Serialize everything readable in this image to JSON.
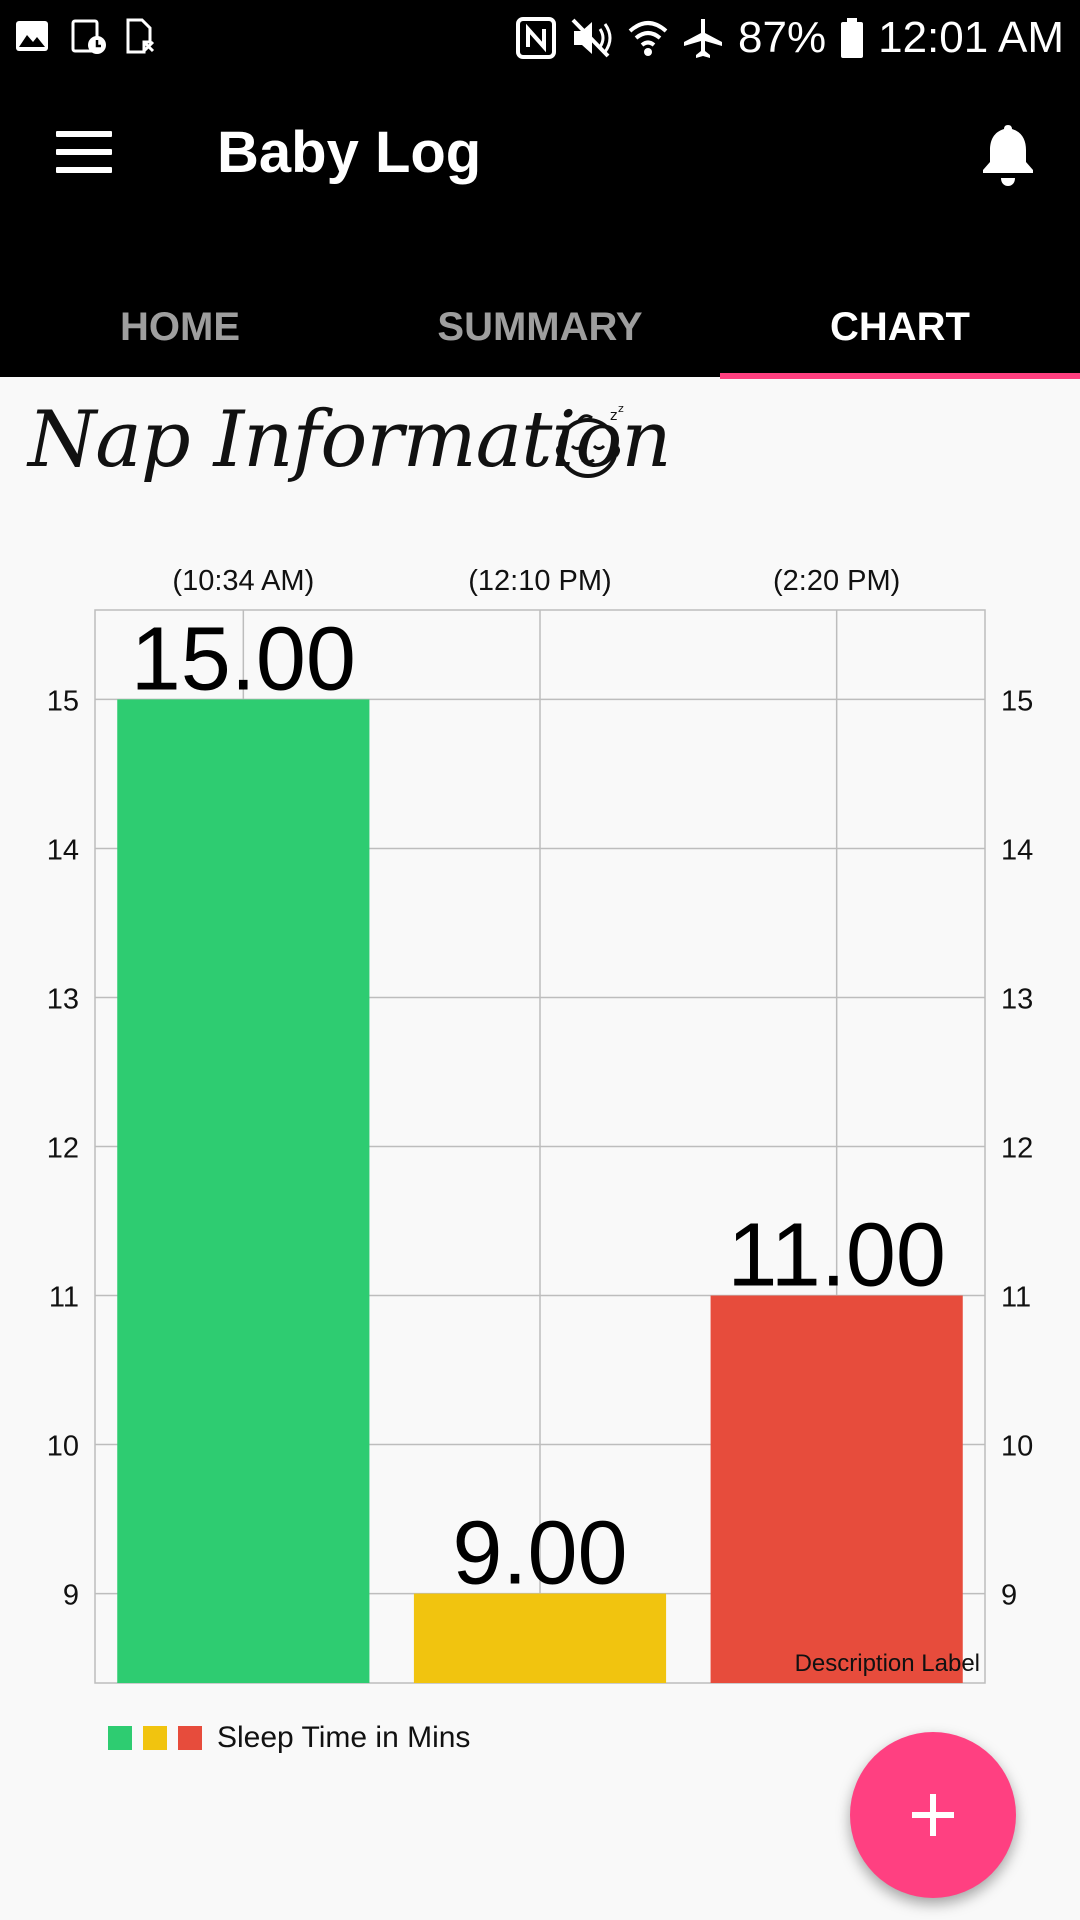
{
  "status_bar": {
    "icons_left": [
      "gallery-icon",
      "schedule-icon",
      "sim-icon"
    ],
    "icons_right": [
      "nfc-icon",
      "mute-icon",
      "wifi-icon",
      "airplane-icon"
    ],
    "battery": "87%",
    "time": "12:01 AM"
  },
  "app_bar": {
    "title": "Baby Log",
    "menu_icon": "hamburger-menu-icon",
    "notification_icon": "bell-icon"
  },
  "tabs": [
    {
      "label": "HOME",
      "active": false
    },
    {
      "label": "SUMMARY",
      "active": false
    },
    {
      "label": "CHART",
      "active": true
    }
  ],
  "section": {
    "title": "Nap Information",
    "icon": "sleeping-baby-icon"
  },
  "chart_data": {
    "type": "bar",
    "categories": [
      "(10:34 AM)",
      "(12:10 PM)",
      "(2:20 PM)"
    ],
    "values": [
      15.0,
      9.0,
      11.0
    ],
    "value_labels": [
      "15.00",
      "9.00",
      "11.00"
    ],
    "colors": [
      "#2ecc71",
      "#f1c40f",
      "#e74c3c"
    ],
    "ylim": [
      8.4,
      15.6
    ],
    "yticks": [
      9,
      10,
      11,
      12,
      13,
      14,
      15
    ],
    "y_axis_left": true,
    "y_axis_right": true,
    "grid": true,
    "description": "Description Label",
    "legend": {
      "label": "Sleep Time in Mins",
      "position": "bottom-left"
    }
  },
  "fab": {
    "icon": "plus-icon"
  },
  "colors": {
    "accent": "#ff4081",
    "tab_indicator": "#ff3f7f",
    "bar_background": "#000000",
    "background": "#f9f9f9"
  }
}
